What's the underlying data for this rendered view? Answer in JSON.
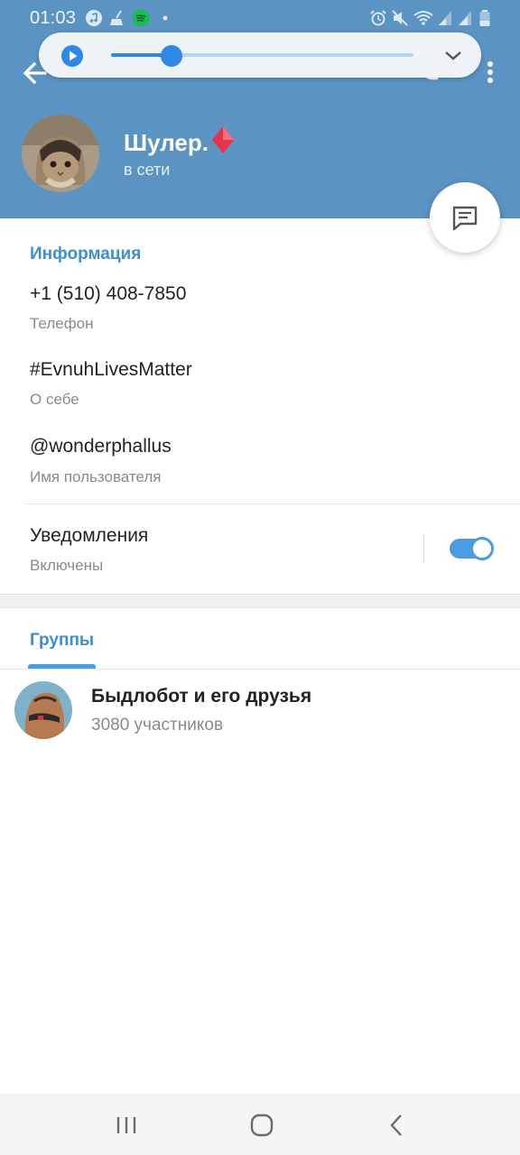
{
  "status_bar": {
    "time": "01:03",
    "icons": [
      "music-icon",
      "cleaner-icon",
      "spotify-icon",
      "dot-icon",
      "alarm-icon",
      "mute-icon",
      "wifi-icon",
      "signal-icon",
      "signal-icon",
      "battery-icon"
    ]
  },
  "player": {
    "progress": 0.2
  },
  "profile": {
    "name": "Шулер.",
    "status": "в сети"
  },
  "info": {
    "section_title": "Информация",
    "phone_value": "+1 (510) 408-7850",
    "phone_label": "Телефон",
    "bio_value": "#EvnuhLivesMatter",
    "bio_label": "О себе",
    "username_value": "@wonderphallus",
    "username_label": "Имя пользователя"
  },
  "notifications": {
    "title": "Уведомления",
    "status": "Включены",
    "enabled": true
  },
  "groups": {
    "tab_label": "Группы",
    "items": [
      {
        "name": "Быдлобот и его друзья",
        "members": "3080 участников"
      }
    ]
  },
  "colors": {
    "header": "#5b93c3",
    "accent": "#4a9ce0",
    "section_title": "#3d8fcf"
  }
}
